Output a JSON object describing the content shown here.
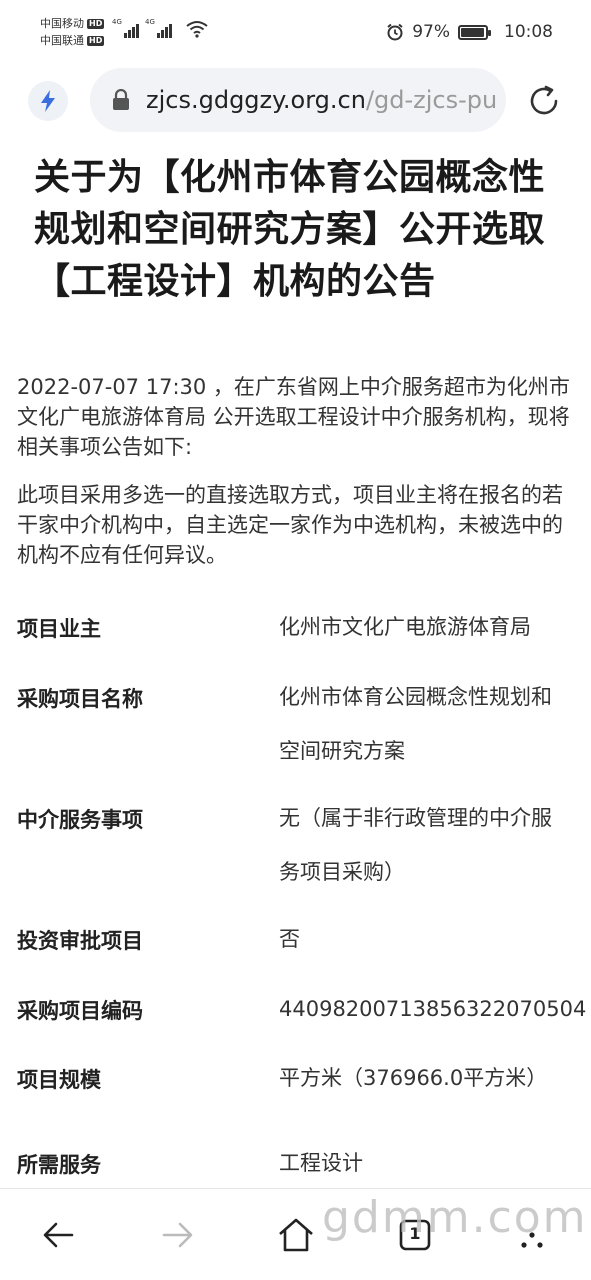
{
  "status_bar": {
    "carrier_1": "中国移动",
    "carrier_2": "中国联通",
    "hd_badge": "HD",
    "network_1": "4G",
    "network_2": "4G",
    "battery_percent": "97%",
    "battery_level": 0.97,
    "time": "10:08"
  },
  "browser": {
    "url_domain": "zjcs.gdggzy.org.cn",
    "url_path": "/gd-zjcs-pu",
    "icons": [
      "bolt-icon",
      "lock-icon",
      "reload-icon"
    ]
  },
  "article": {
    "title": "关于为【化州市体育公园概念性规划和空间研究方案】公开选取【工程设计】机构的公告",
    "intro": "2022-07-07 17:30 ，在广东省网上中介服务超市为化州市文化广电旅游体育局 公开选取工程设计中介服务机构，现将相关事项公告如下:",
    "method": "此项目采用多选一的直接选取方式，项目业主将在报名的若干家中介机构中，自主选定一家作为中选机构，未被选中的机构不应有任何异议。",
    "rows": [
      {
        "label": "项目业主",
        "value": "化州市文化广电旅游体育局"
      },
      {
        "label": "采购项目名称",
        "value": "化州市体育公园概念性规划和空间研究方案"
      },
      {
        "label": "中介服务事项",
        "value": "无（属于非行政管理的中介服务项目采购）"
      },
      {
        "label": "投资审批项目",
        "value": "否"
      },
      {
        "label": "采购项目编码",
        "value": "44098200713856322070504"
      },
      {
        "label": "项目规模",
        "value": "平方米（376966.0平方米）"
      },
      {
        "label": "所需服务",
        "value": "工程设计"
      }
    ]
  },
  "bottom_nav": {
    "tab_count": "1",
    "icons": [
      "back-arrow-icon",
      "forward-arrow-icon",
      "home-icon",
      "tabs-icon",
      "more-icon"
    ]
  },
  "watermark": "gdmm.com"
}
